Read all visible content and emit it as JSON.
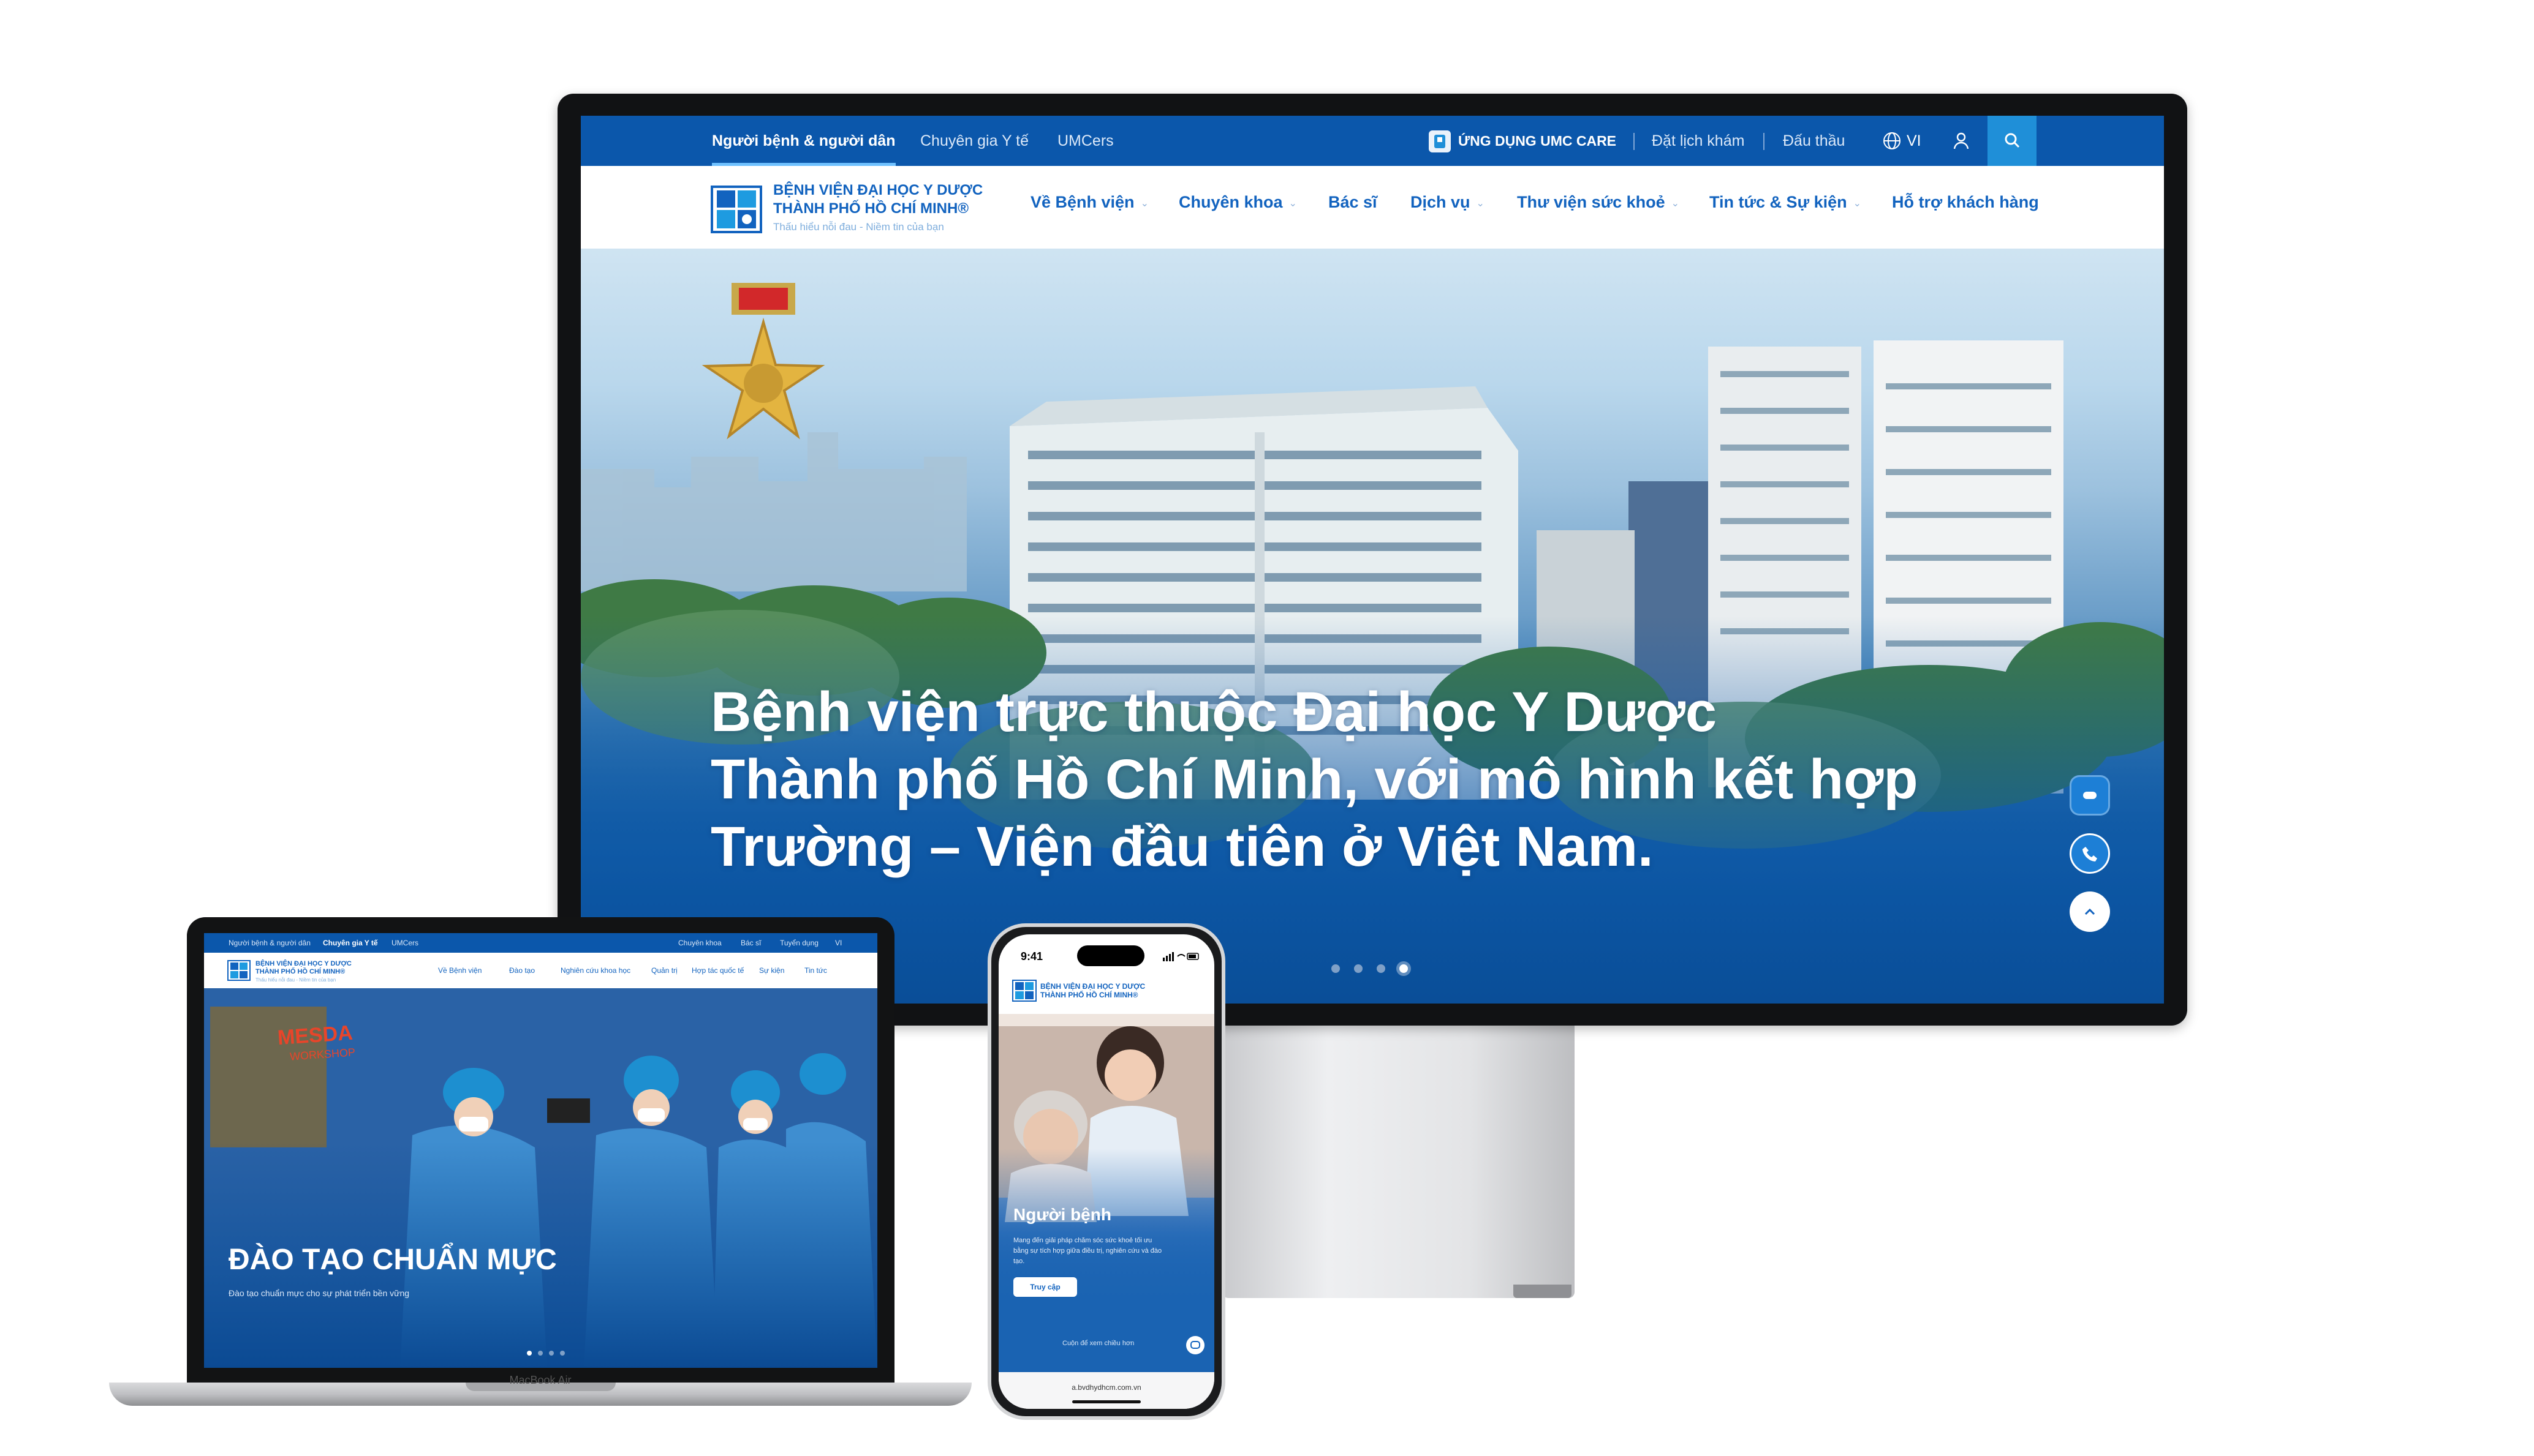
{
  "monitor": {
    "topbar": {
      "tabs": [
        "Người bệnh & người dân",
        "Chuyên gia Y tế",
        "UMCers"
      ],
      "app_label": "ỨNG DỤNG UMC CARE",
      "booking": "Đặt lịch khám",
      "bidding": "Đấu thầu",
      "language": "VI"
    },
    "logo": {
      "line1": "BỆNH VIỆN ĐẠI HỌC Y DƯỢC",
      "line2": "THÀNH PHỐ HỒ CHÍ MINH®",
      "tagline": "Thấu hiểu nỗi đau - Niềm tin của bạn"
    },
    "nav": [
      "Về Bệnh viện",
      "Chuyên khoa",
      "Bác sĩ",
      "Dịch vụ",
      "Thư viện sức khoẻ",
      "Tin tức & Sự kiện",
      "Hỗ trợ khách hàng"
    ],
    "hero": {
      "line1": "Bệnh viện trực thuộc Đại học Y Dược",
      "line2": "Thành phố Hồ Chí Minh, với mô hình kết hợp",
      "line3": "Trường – Viện đầu tiên ở Việt Nam.",
      "slides": 4,
      "active_slide": 4
    },
    "colors": {
      "primary": "#0b57ab",
      "accent": "#1f8fd8"
    }
  },
  "laptop": {
    "label": "MacBook Air",
    "topbar": {
      "tabs": [
        "Người bệnh & người dân",
        "Chuyên gia Y tế",
        "UMCers"
      ],
      "right": [
        "Chuyên khoa",
        "Bác sĩ",
        "Tuyển dụng",
        "VI"
      ]
    },
    "logo": {
      "line1": "BỆNH VIỆN ĐẠI HỌC Y DƯỢC",
      "line2": "THÀNH PHỐ HỒ CHÍ MINH®",
      "tagline": "Thấu hiểu nỗi đau - Niềm tin của bạn"
    },
    "nav": [
      "Về Bệnh viện",
      "Đào tạo",
      "Nghiên cứu khoa học",
      "Quản trị",
      "Hợp tác quốc tế",
      "Sự kiện",
      "Tin tức"
    ],
    "hero": {
      "title": "ĐÀO TẠO CHUẨN MỰC",
      "subtitle": "Đào tạo chuẩn mực cho sự phát triển bền vững",
      "banner": "MESDA",
      "banner_sub": "WORKSHOP",
      "slides": 4,
      "active_slide": 1
    }
  },
  "phone": {
    "time": "9:41",
    "logo": {
      "line1": "BỆNH VIỆN ĐẠI HỌC Y DƯỢC",
      "line2": "THÀNH PHỐ HỒ CHÍ MINH®"
    },
    "hero": {
      "title": "Người bệnh",
      "body1": "Mang đến giải pháp chăm sóc sức khoẻ tối ưu",
      "body2": "bằng sự tích hợp giữa điều trị, nghiên cứu và đào",
      "body3": "tạo.",
      "cta": "Truy cập",
      "scroll_hint": "Cuộn để xem chiều hơn"
    },
    "url": "a.bvdhydhcm.com.vn"
  }
}
